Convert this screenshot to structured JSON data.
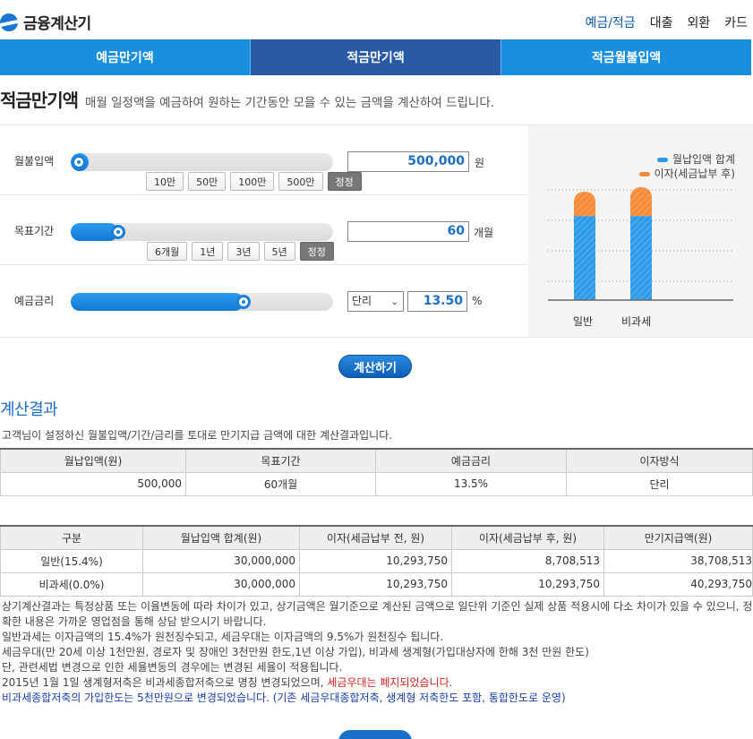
{
  "header": {
    "logo_text": "금융계산기",
    "nav": [
      "예금/적금",
      "대출",
      "외환",
      "카드"
    ]
  },
  "tabs": [
    "예금만기액",
    "적금만기액",
    "적금월불입액"
  ],
  "page": {
    "title": "적금만기액",
    "subtitle": "매월 일정액을 예금하여 원하는 기간동안 모을 수 있는 금액을 계산하여 드립니다."
  },
  "inputs": {
    "monthly": {
      "label": "월불입액",
      "value": "500,000",
      "unit": "원",
      "slider_fraction": 0.03,
      "buttons": [
        "10만",
        "50만",
        "100만",
        "500만"
      ],
      "reset": "정정"
    },
    "period": {
      "label": "목표기간",
      "value": "60",
      "unit": "개월",
      "slider_fraction": 0.18,
      "buttons": [
        "6개월",
        "1년",
        "3년",
        "5년"
      ],
      "reset": "정정"
    },
    "rate": {
      "label": "예금금리",
      "method": "단리",
      "value": "13.50",
      "unit": "%",
      "slider_fraction": 0.66
    }
  },
  "chart": {
    "legend": [
      "월납입액 합계",
      "이자(세금납부 후)"
    ],
    "colors": {
      "principal": "#2e9be8",
      "interest": "#f68b3a"
    },
    "categories": [
      "일반",
      "비과세"
    ]
  },
  "chart_data": {
    "type": "bar",
    "stacked": true,
    "categories": [
      "일반",
      "비과세"
    ],
    "series": [
      {
        "name": "월납입액 합계",
        "values": [
          30000000,
          30000000
        ]
      },
      {
        "name": "이자(세금납부 후)",
        "values": [
          8708513,
          10293750
        ]
      }
    ]
  },
  "calc_button": "계산하기",
  "result": {
    "title": "계산결과",
    "desc": "고객님이 설정하신 월불입액/기간/금리를 토대로 만기지급 금액에 대한 계산결과입니다.",
    "summary_headers": [
      "월납입액(원)",
      "목표기간",
      "예금금리",
      "이자방식"
    ],
    "summary_row": [
      "500,000",
      "60개월",
      "13.5%",
      "단리"
    ],
    "detail_headers": [
      "구분",
      "월납입액 합계(원)",
      "이자(세금납부 전, 원)",
      "이자(세금납부 후, 원)",
      "만기지급액(원)"
    ],
    "detail_rows": [
      [
        "일반(15.4%)",
        "30,000,000",
        "10,293,750",
        "8,708,513",
        "38,708,513"
      ],
      [
        "비과세(0.0%)",
        "30,000,000",
        "10,293,750",
        "10,293,750",
        "40,293,750"
      ]
    ]
  },
  "notes": {
    "line1": "상기계산결과는 특정상품 또는 이율변동에 따라 차이가 있고, 상기금액은 월기준으로 계산된 금액으로 일단위 기준인 실제 상품 적용시에 다소 차이가 있을 수 있으니, 정확한 내용은 가까운 영업점을 통해 상담 받으시기 바랍니다.",
    "line2": "일반과세는 이자금액의 15.4%가 원천징수되고, 세금우대는 이자금액의 9.5%가 원천징수 됩니다.",
    "line3": "세금우대(만 20세 이상 1천만원, 경로자 및 장애인 3천만원 한도,1년 이상 가입), 비과세 생계형(가입대상자에 한해 3천 만원 한도)",
    "line4": "단, 관련세법 변경으로 인한 세율변동의 경우에는 변경된 세율이 적용됩니다.",
    "line5a": "2015년 1월 1일 생계형저축은 비과세종합저축으로 명칭 변경되었으며, ",
    "line5b": "세금우대는 폐지되었습니다.",
    "line6": "비과세종합저축의 가입한도는 5천만원으로 변경되었습니다. (기존 세금우대종합저축, 생계형 저축한도 포함, 통합한도로 운영)"
  }
}
